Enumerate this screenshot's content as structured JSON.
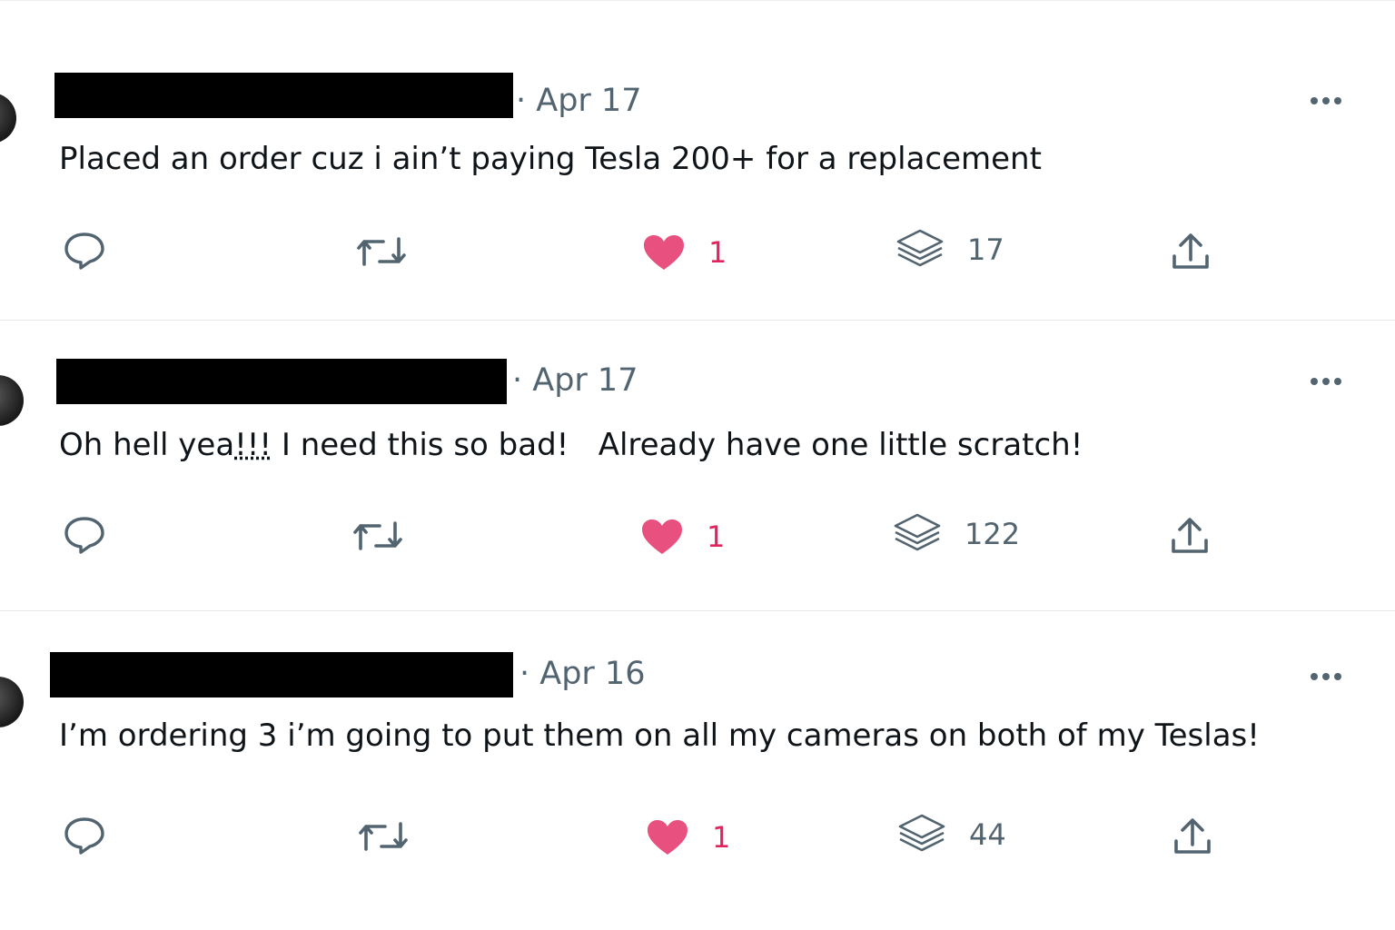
{
  "posts": [
    {
      "date": "· Apr 17",
      "text": "Placed an order cuz i ain’t paying Tesla 200+ for a replacement",
      "likes": "1",
      "views": "17",
      "liked": true
    },
    {
      "date": "· Apr 17",
      "text_before": "Oh hell yea",
      "text_underlined": "!!!",
      "text_after": " I need this so bad!   Already have one little scratch!",
      "likes": "1",
      "views": "122",
      "liked": true
    },
    {
      "date": "· Apr 16",
      "text": "I’m ordering 3 i’m going to put them on all my cameras on both of my Teslas!",
      "likes": "1",
      "views": "44",
      "liked": true
    }
  ],
  "icons": {
    "reply": "reply-icon",
    "repost": "repost-icon",
    "like": "heart-icon",
    "views": "views-icon",
    "share": "share-icon",
    "more": "more-icon"
  },
  "colors": {
    "like": "#e0245e",
    "icon": "#536471",
    "text": "#0f1419",
    "divider": "#e6e9eb"
  }
}
